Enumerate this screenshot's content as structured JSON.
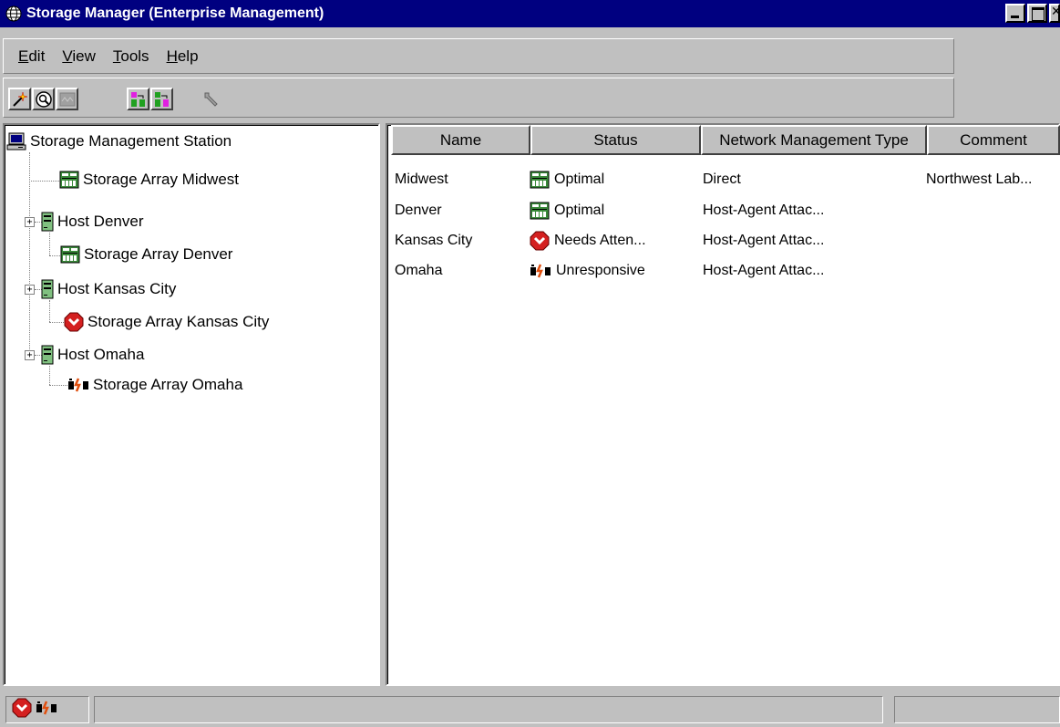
{
  "window": {
    "title": "Storage Manager (Enterprise Management)",
    "icon": "globe-icon"
  },
  "menubar": {
    "items": [
      {
        "accel": "E",
        "rest": "dit"
      },
      {
        "accel": "V",
        "rest": "iew"
      },
      {
        "accel": "T",
        "rest": "ools"
      },
      {
        "accel": "H",
        "rest": "elp"
      }
    ]
  },
  "toolbar": {
    "buttons": [
      "new-storage-array-icon",
      "automatic-discovery-icon",
      "rescan-icon",
      "add-host-icon",
      "remove-host-icon",
      "configure-alerts-icon"
    ]
  },
  "tree": {
    "root": "Storage Management Station",
    "nodes": [
      {
        "label": "Storage Array Midwest",
        "icon": "storage-array-optimal-icon"
      },
      {
        "label": "Host Denver",
        "icon": "host-icon"
      },
      {
        "label": "Storage Array Denver",
        "icon": "storage-array-optimal-icon"
      },
      {
        "label": "Host Kansas City",
        "icon": "host-icon"
      },
      {
        "label": "Storage Array Kansas City",
        "icon": "needs-attention-icon"
      },
      {
        "label": "Host Omaha",
        "icon": "host-icon"
      },
      {
        "label": "Storage Array Omaha",
        "icon": "unresponsive-icon"
      }
    ]
  },
  "table": {
    "columns": [
      "Name",
      "Status",
      "Network Management Type",
      "Comment"
    ],
    "rows": [
      {
        "name": "Midwest",
        "status": "Optimal",
        "status_icon": "optimal-icon",
        "type": "Direct",
        "comment": "Northwest Lab..."
      },
      {
        "name": "Denver",
        "status": "Optimal",
        "status_icon": "optimal-icon",
        "type": "Host-Agent Attac...",
        "comment": ""
      },
      {
        "name": "Kansas City",
        "status": "Needs Atten...",
        "status_icon": "needs-attention-icon",
        "type": "Host-Agent Attac...",
        "comment": ""
      },
      {
        "name": "Omaha",
        "status": "Unresponsive",
        "status_icon": "unresponsive-icon",
        "type": "Host-Agent Attac...",
        "comment": ""
      }
    ]
  },
  "statusbar": {
    "icons": [
      "needs-attention-icon",
      "unresponsive-icon"
    ]
  },
  "colors": {
    "titlebar": "#000080",
    "needs_attention": "#d42020",
    "optimal": "#3a8a3a",
    "face": "#c0c0c0"
  }
}
